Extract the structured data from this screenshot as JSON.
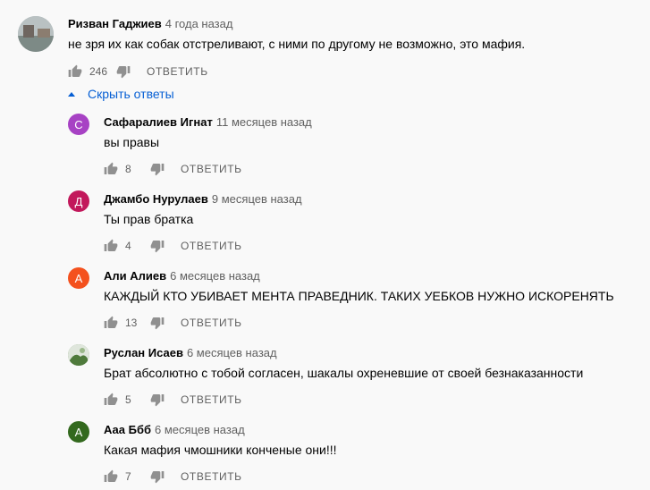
{
  "top_comment": {
    "author": "Ризван Гаджиев",
    "time": "4 года назад",
    "text": "не зря их как собак отстреливают, с ними по другому не возможно,  это мафия.",
    "likes": "246",
    "reply_label": "ОТВЕТИТЬ"
  },
  "replies_toggle": {
    "label": "Скрыть ответы",
    "icon": "chevron-up-icon"
  },
  "replies": [
    {
      "author": "Сафаралиев Игнат",
      "time": "11 месяцев назад",
      "text": "вы правы",
      "likes": "8",
      "avatar_letter": "С",
      "avatar_color": "#a742c4",
      "reply_label": "ОТВЕТИТЬ"
    },
    {
      "author": "Джамбо Нурулаев",
      "time": "9 месяцев назад",
      "text": "Ты прав братка",
      "likes": "4",
      "avatar_letter": "Д",
      "avatar_color": "#c2185b",
      "reply_label": "ОТВЕТИТЬ"
    },
    {
      "author": "Али Алиев",
      "time": "6 месяцев назад",
      "text": "КАЖДЫЙ КТО УБИВАЕТ МЕНТА ПРАВЕДНИК. ТАКИХ УЕБКОВ НУЖНО ИСКОРЕНЯТЬ",
      "likes": "13",
      "avatar_letter": "А",
      "avatar_color": "#f4511e",
      "reply_label": "ОТВЕТИТЬ"
    },
    {
      "author": "Руслан Исаев",
      "time": "6 месяцев назад",
      "text": "Брат абсолютно с тобой согласен, шакалы охреневшие от своей безнаказанности",
      "likes": "5",
      "avatar_letter": "",
      "avatar_color": "#6b8e5a",
      "reply_label": "ОТВЕТИТЬ"
    },
    {
      "author": "Ааа Ббб",
      "time": "6 месяцев назад",
      "text": "Какая мафия чмошники конченые они!!!",
      "likes": "7",
      "avatar_letter": "А",
      "avatar_color": "#33691e",
      "reply_label": "ОТВЕТИТЬ"
    }
  ]
}
